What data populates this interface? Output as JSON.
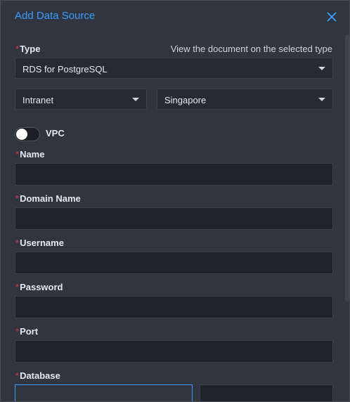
{
  "dialog": {
    "title": "Add Data Source",
    "close_icon": "close-icon"
  },
  "type": {
    "label": "Type",
    "doc_link": "View the document on the selected type",
    "value": "RDS for PostgreSQL"
  },
  "network": {
    "value": "Intranet"
  },
  "region": {
    "value": "Singapore"
  },
  "vpc": {
    "label": "VPC",
    "enabled": false
  },
  "fields": {
    "name": {
      "label": "Name",
      "value": ""
    },
    "domain_name": {
      "label": "Domain Name",
      "value": ""
    },
    "username": {
      "label": "Username",
      "value": ""
    },
    "password": {
      "label": "Password",
      "value": ""
    },
    "port": {
      "label": "Port",
      "value": ""
    },
    "database": {
      "label": "Database"
    }
  },
  "buttons": {
    "test_label": ""
  },
  "required_mark": "*",
  "colors": {
    "accent": "#3c9cff",
    "required": "#e0394b",
    "background": "#303540",
    "input": "#1f232a"
  }
}
